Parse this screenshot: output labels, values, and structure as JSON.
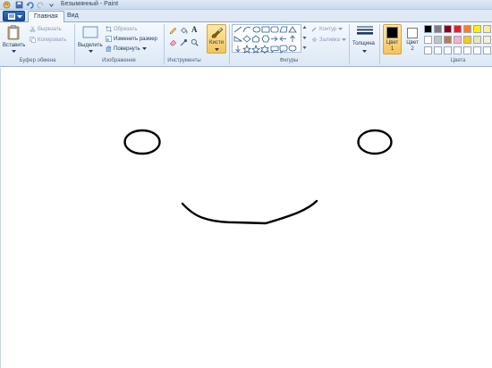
{
  "window": {
    "title": "Безымянный - Paint"
  },
  "tabs": {
    "home": "Главная",
    "view": "Вид"
  },
  "clipboard": {
    "paste": "Вставить",
    "cut": "Вырезать",
    "copy": "Копировать",
    "group": "Буфер обмена"
  },
  "image": {
    "select": "Выделить",
    "crop": "Обрезать",
    "resize": "Изменить размер",
    "rotate": "Повернуть",
    "group": "Изображение"
  },
  "tools": {
    "group": "Инструменты",
    "text_tool": "A"
  },
  "brushes": {
    "label": "Кисти"
  },
  "shapes": {
    "outline": "Контур",
    "fill": "Заливка",
    "group": "Фигуры"
  },
  "size": {
    "label": "Толщина"
  },
  "colors": {
    "color1_label": "Цвет",
    "color1_num": "1",
    "color2_label": "Цвет",
    "color2_num": "2",
    "group": "Цвета",
    "color1_value": "#000000",
    "color2_value": "#ffffff",
    "palette_row1": [
      "#000000",
      "#7f7f7f",
      "#880015",
      "#ed1c24",
      "#ff7f27",
      "#fff200",
      "#ffe8a0"
    ],
    "palette_row2": [
      "#ffffff",
      "#c3c3c3",
      "#b97a57",
      "#ffaec9",
      "#ffc90e",
      "#efe4b0",
      "#f7f0c8"
    ],
    "palette_row3": [
      "#ffffff",
      "#ffffff",
      "#ffffff",
      "#ffffff",
      "#ffffff",
      "#ffffff",
      "#ffffff"
    ]
  },
  "canvas": {
    "stroke_color": "#000000"
  }
}
